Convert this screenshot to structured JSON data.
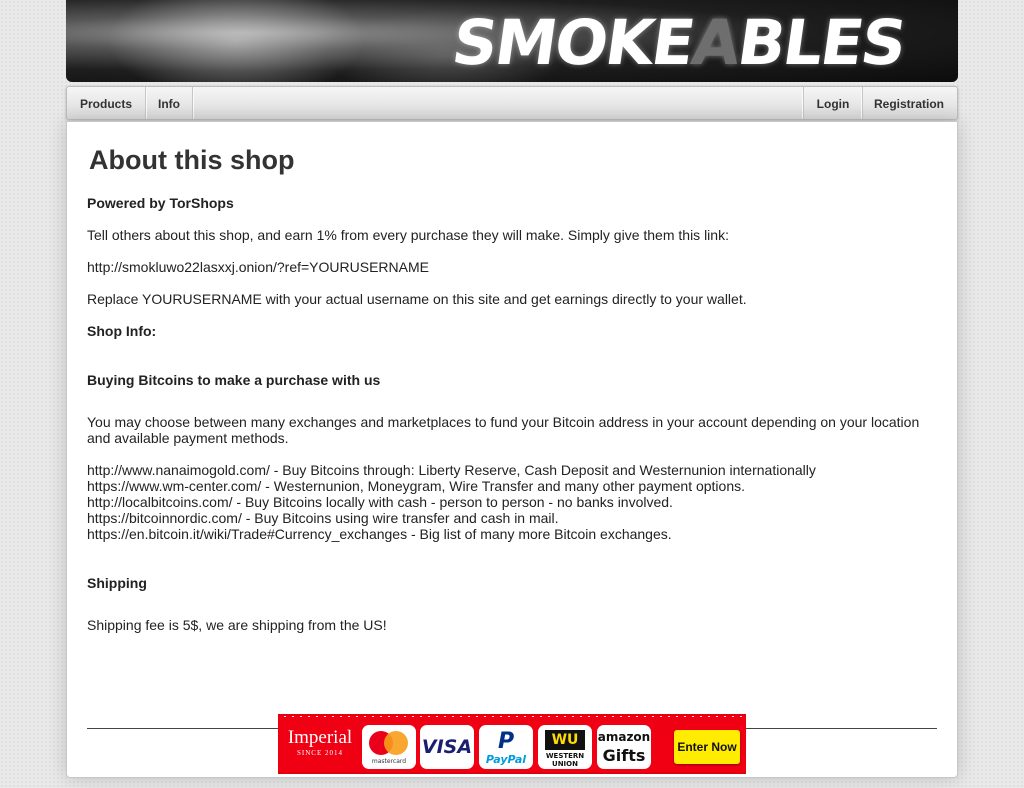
{
  "header": {
    "logo_before": "SMOKE",
    "logo_a": "A",
    "logo_after": "BLES"
  },
  "nav": {
    "left": [
      "Products",
      "Info"
    ],
    "right": [
      "Login",
      "Registration"
    ]
  },
  "main": {
    "title": "About this shop",
    "powered": "Powered by TorShops",
    "referral_intro": "Tell others about this shop, and earn 1% from every purchase they will make. Simply give them this link:",
    "referral_link": "http://smokluwo22lasxxj.onion/?ref=YOURUSERNAME",
    "referral_note": "Replace YOURUSERNAME with your actual username on this site and get earnings directly to your wallet.",
    "shop_info_label": "Shop Info:",
    "bitcoin_heading": "Buying Bitcoins to make a purchase with us",
    "bitcoin_intro": "You may choose between many exchanges and marketplaces to fund your Bitcoin address in your account depending on your location and available payment methods.",
    "exchanges": [
      "http://www.nanaimogold.com/ - Buy Bitcoins through: Liberty Reserve, Cash Deposit and Westernunion internationally",
      "https://www.wm-center.com/ - Westernunion, Moneygram, Wire Transfer and many other payment options.",
      "http://localbitcoins.com/ - Buy Bitcoins locally with cash - person to person - no banks involved.",
      "https://bitcoinnordic.com/ - Buy Bitcoins using wire transfer and cash in mail.",
      "https://en.bitcoin.it/wiki/Trade#Currency_exchanges - Big list of many more Bitcoin exchanges."
    ],
    "shipping_heading": "Shipping",
    "shipping_text": "Shipping fee is 5$, we are shipping from the US!"
  },
  "ad": {
    "brand": "Imperial",
    "brand_sub": "SINCE 2014",
    "mastercard": "mastercard",
    "visa": "VISA",
    "paypal_p": "P",
    "paypal": "PayPal",
    "wu_logo": "WU",
    "wu": "WESTERN UNION",
    "amazon": "amazon",
    "gifts": "Gifts",
    "cta": "Enter Now"
  },
  "colors": {
    "ad_red": "#f00013",
    "cta_yellow": "#ffec00"
  }
}
